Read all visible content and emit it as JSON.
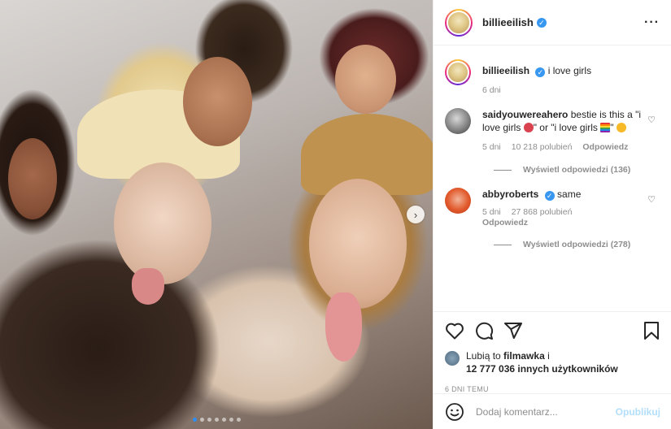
{
  "post": {
    "username": "billieeilish",
    "verified": true
  },
  "caption": {
    "username": "billieeilish",
    "text": "i love girls",
    "time": "6 dni"
  },
  "comments": [
    {
      "username": "saidyouwereahero",
      "text_a": "bestie is this a \"i love girls",
      "text_b": "\" or \"i love girls",
      "text_c": "\"",
      "time": "5 dni",
      "likes": "10 218 polubień",
      "reply": "Odpowiedz",
      "view_replies": "Wyświetl odpowiedzi (136)"
    },
    {
      "username": "abbyroberts",
      "verified": true,
      "text": "same",
      "time": "5 dni",
      "likes": "27 868 polubień",
      "reply": "Odpowiedz",
      "view_replies": "Wyświetl odpowiedzi (278)"
    }
  ],
  "likes": {
    "prefix": "Lubią to",
    "user": "filmawka",
    "and": "i",
    "others": "12 777 036 innych użytkowników"
  },
  "posted_ago": "6 DNI TEMU",
  "comment_box": {
    "placeholder": "Dodaj komentarz...",
    "publish": "Opublikuj"
  },
  "carousel": {
    "slides": 7,
    "active": 0
  },
  "icons": {
    "more": "more-options-icon",
    "like": "heart-icon",
    "comment": "comment-icon",
    "share": "share-icon",
    "save": "bookmark-icon",
    "emoji": "smiley-icon",
    "next": "chevron-right-icon"
  },
  "colors": {
    "verified": "#3897f0",
    "publish": "#b2dffc",
    "dot_active": "#2f8ef5"
  }
}
